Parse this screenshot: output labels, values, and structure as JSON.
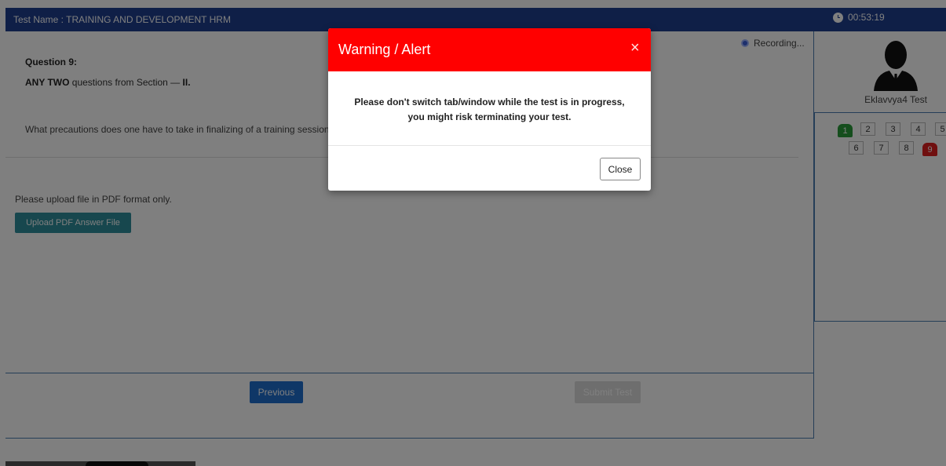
{
  "header": {
    "test_name": "Test Name : TRAINING AND DEVELOPMENT HRM",
    "timer": "00:53:19"
  },
  "question": {
    "number_label": "Question 9:",
    "instruction_bold": "ANY TWO",
    "instruction_text": " questions from Section — ",
    "instruction_section": "II.",
    "text": "What precautions does one have to take in finalizing of a training session?"
  },
  "upload": {
    "note": "Please upload file in PDF format only.",
    "button_label": "Upload PDF Answer File"
  },
  "recording": {
    "label": "Recording..."
  },
  "navigation": {
    "previous_label": "Previous",
    "submit_label": "Submit Test"
  },
  "user": {
    "name": "Eklavvya4 Test"
  },
  "palette": {
    "row1": [
      "1",
      "2",
      "3",
      "4",
      "5"
    ],
    "row2": [
      "6",
      "7",
      "8",
      "9"
    ]
  },
  "modal": {
    "title": "Warning / Alert",
    "close_icon": "×",
    "message_line1": "Please don't switch tab/window while the test is in progress,",
    "message_line2": "you might risk terminating your test.",
    "close_button": "Close"
  },
  "colors": {
    "header_bg": "#1f3f8f",
    "modal_header": "#ff0000",
    "answered": "#2a9d3a",
    "current": "#e02020",
    "upload_button": "#2f8f9d",
    "previous_button": "#1f6fcf"
  }
}
